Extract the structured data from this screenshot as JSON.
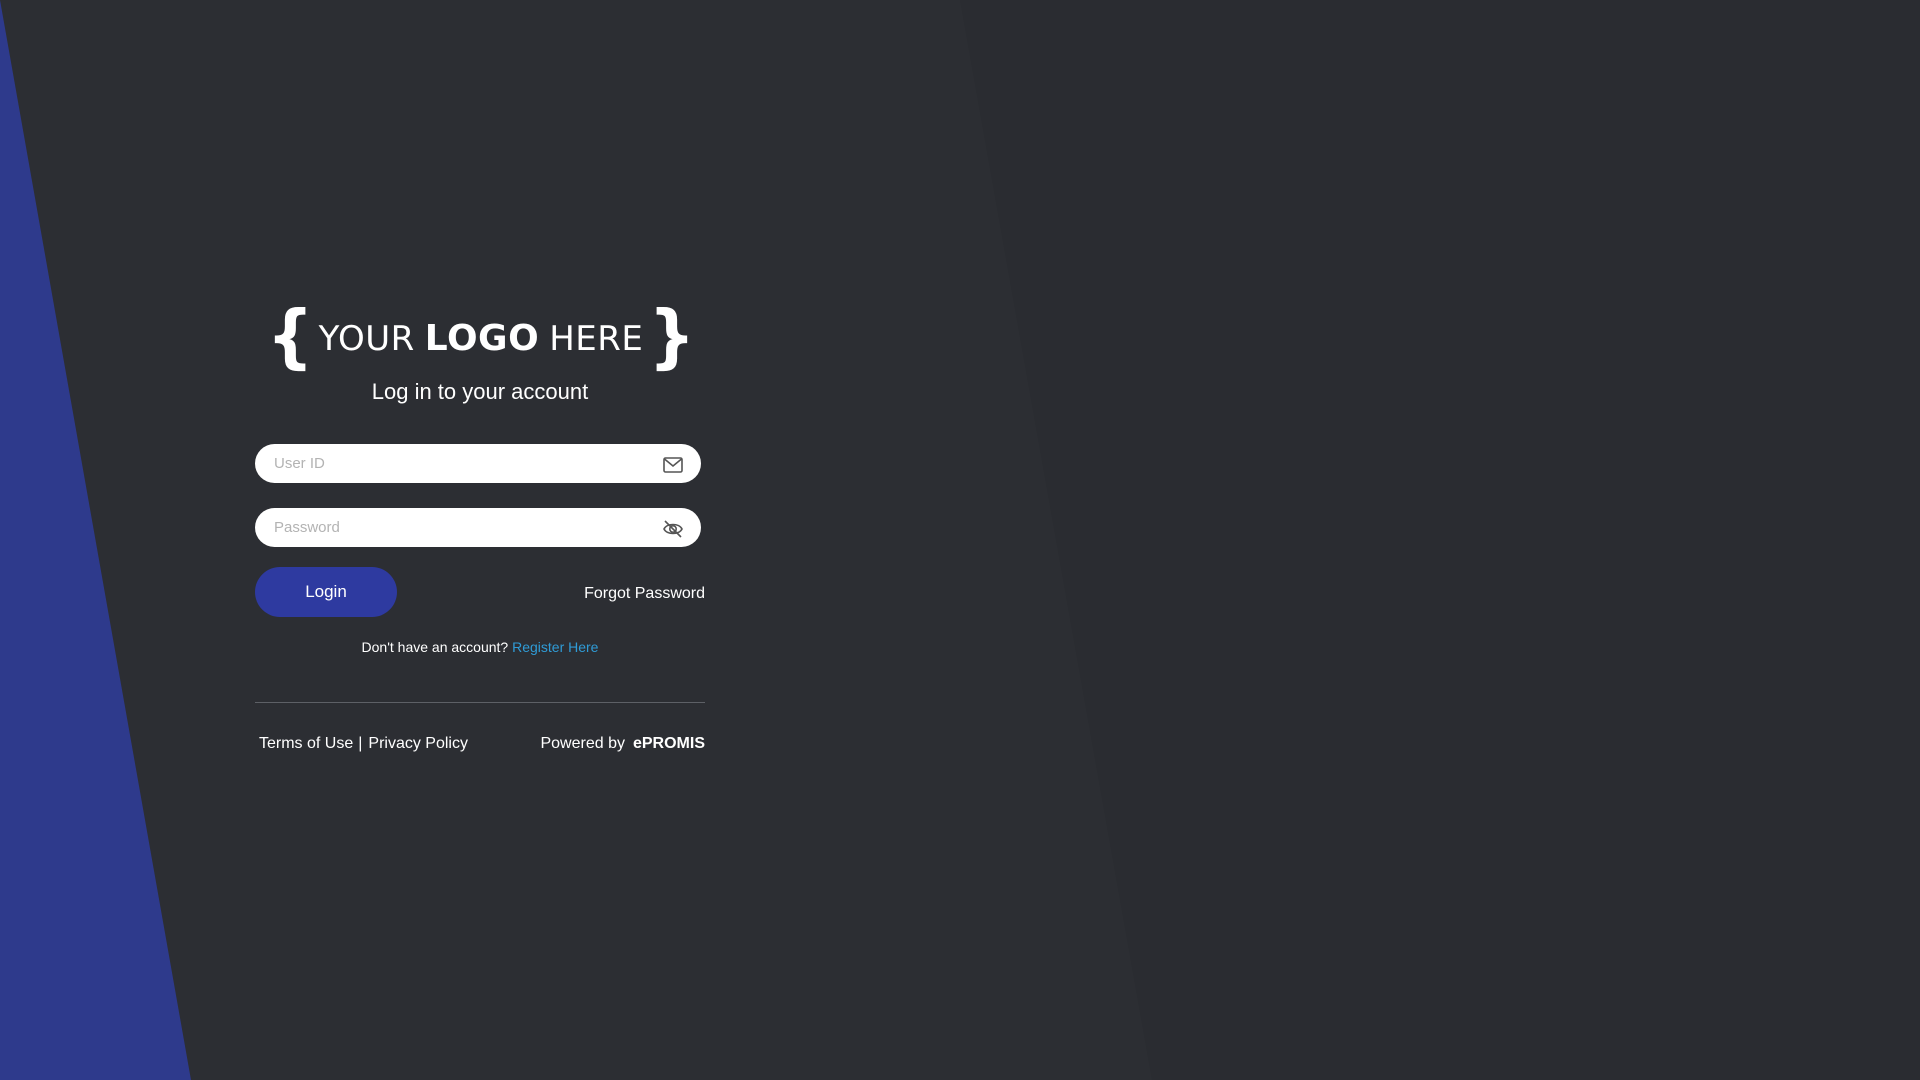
{
  "logo": {
    "open_brace": "{",
    "word1": "YOUR",
    "word2": "LOGO",
    "word3": "HERE",
    "close_brace": "}"
  },
  "header": {
    "subtitle": "Log in to your account"
  },
  "form": {
    "userid": {
      "placeholder": "User ID",
      "value": "",
      "icon": "mail-icon"
    },
    "password": {
      "placeholder": "Password",
      "value": "",
      "icon": "eye-off-icon"
    },
    "login_label": "Login",
    "forgot_label": "Forgot Password"
  },
  "register": {
    "prompt": "Don't have an account?",
    "link_label": "Register Here"
  },
  "footer": {
    "terms_label": "Terms of Use",
    "separator": "|",
    "privacy_label": "Privacy Policy",
    "powered_label": "Powered by",
    "brand": "ePROMIS"
  },
  "colors": {
    "background": "#2c2e33",
    "accent_blue": "#2e3aa0",
    "left_stripe": "#2e3a8c",
    "link": "#2f9bd6"
  }
}
